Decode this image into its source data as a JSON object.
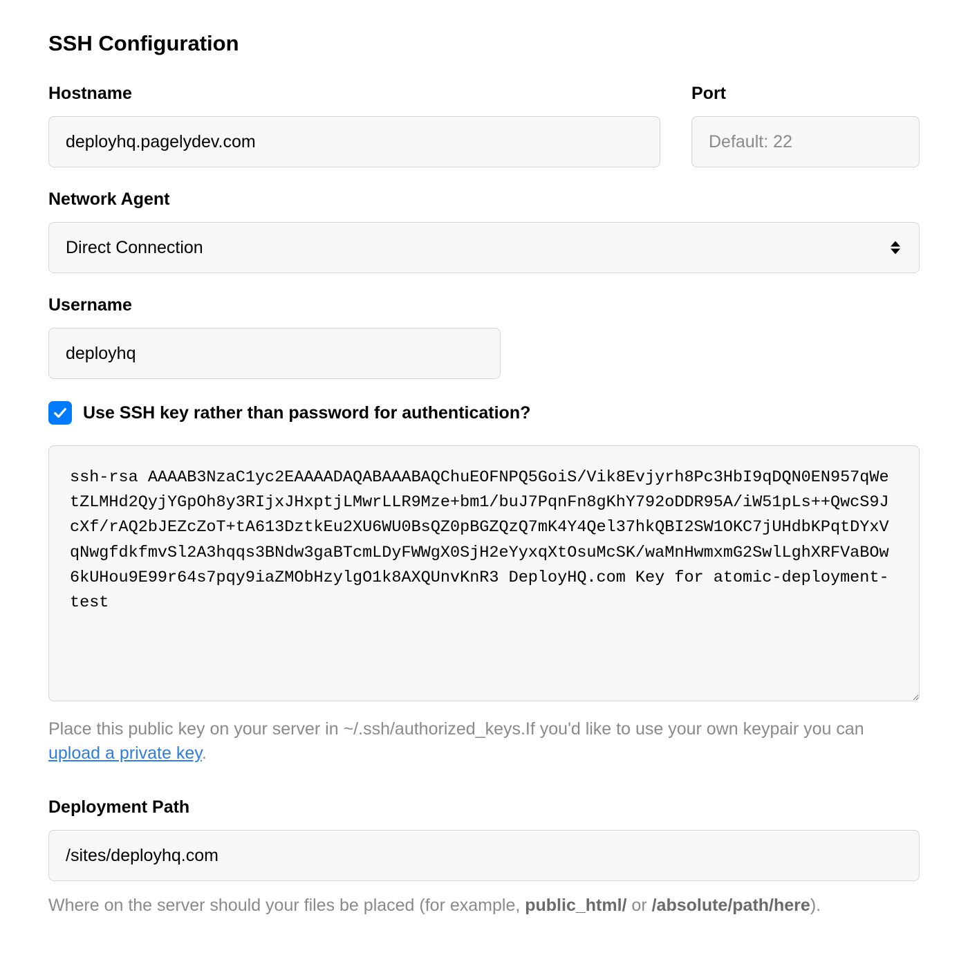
{
  "page_title": "SSH Configuration",
  "hostname": {
    "label": "Hostname",
    "value": "deployhq.pagelydev.com"
  },
  "port": {
    "label": "Port",
    "placeholder": "Default: 22",
    "value": ""
  },
  "network_agent": {
    "label": "Network Agent",
    "value": "Direct Connection"
  },
  "username": {
    "label": "Username",
    "value": "deployhq"
  },
  "use_ssh_key": {
    "label": "Use SSH key rather than password for authentication?",
    "checked": true
  },
  "ssh_key": {
    "value": "ssh-rsa AAAAB3NzaC1yc2EAAAADAQABAAABAQChuEOFNPQ5GoiS/Vik8Evjyrh8Pc3HbI9qDQN0EN957qWetZLMHd2QyjYGpOh8y3RIjxJHxptjLMwrLLR9Mze+bm1/buJ7PqnFn8gKhY792oDDR95A/iW51pLs++QwcS9JcXf/rAQ2bJEZcZoT+tA613DztkEu2XU6WU0BsQZ0pBGZQzQ7mK4Y4Qel37hkQBI2SW1OKC7jUHdbKPqtDYxVqNwgfdkfmvSl2A3hqqs3BNdw3gaBTcmLDyFWWgX0SjH2eYyxqXtOsuMcSK/waMnHwmxmG2SwlLghXRFVaBOw6kUHou9E99r64s7pqy9iaZMObHzylgO1k8AXQUnvKnR3 DeployHQ.com Key for atomic-deployment-test",
    "help_text_before": "Place this public key on your server in ~/.ssh/authorized_keys.If you'd like to use your own keypair you can ",
    "upload_link": "upload a private key",
    "help_text_after": "."
  },
  "deployment_path": {
    "label": "Deployment Path",
    "value": "/sites/deployhq.com",
    "help_before": "Where on the server should your files be placed (for example, ",
    "help_strong1": "public_html/",
    "help_mid": " or ",
    "help_strong2": "/absolute/path/here",
    "help_after": ")."
  }
}
